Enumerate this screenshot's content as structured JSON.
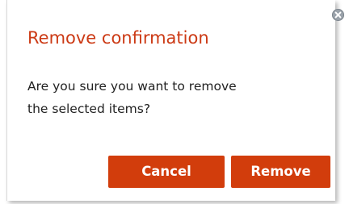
{
  "dialog": {
    "title": "Remove confirmation",
    "message_line1": "Are you sure you want to remove",
    "message_line2": "the selected items?",
    "close_icon": "close-circle-icon",
    "buttons": {
      "cancel_label": "Cancel",
      "remove_label": "Remove"
    }
  },
  "colors": {
    "title": "#cc3a15",
    "button_bg": "#d23d0c",
    "button_text": "#ffffff",
    "close_icon": "#9aa2aa"
  }
}
